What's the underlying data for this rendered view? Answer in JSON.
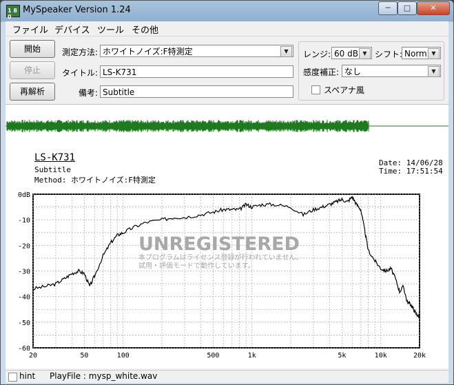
{
  "window": {
    "title": "MySpeaker Version 1.24",
    "icon_label": "1 8 0",
    "min": "─",
    "max": "□",
    "close": "✕"
  },
  "menu": [
    "ファイル",
    "デバイス",
    "ツール",
    "その他"
  ],
  "buttons": {
    "start": "開始",
    "stop": "停止",
    "reanalyze": "再解析"
  },
  "form": {
    "method_label": "測定方法:",
    "method_value": "ホワイトノイズ:F特測定",
    "title_label": "タイトル:",
    "title_value": "LS-K731",
    "note_label": "備考:",
    "note_value": "Subtitle"
  },
  "settings": {
    "range_label": "レンジ:",
    "range_value": "60 dB",
    "shift_label": "シフト:",
    "shift_value": "Norm.",
    "sens_label": "感度補正:",
    "sens_value": "なし",
    "spectrum_label": "スペアナ風",
    "spectrum_checked": false
  },
  "plot_header": {
    "title": "LS-K731",
    "subtitle": "Subtitle",
    "method": "Method:  ホワイトノイズ:F特測定",
    "date": "Date: 14/06/28",
    "time": "Time: 17:51:54"
  },
  "watermark": {
    "main": "UNREGISTERED",
    "line1": "本プログラムはライセンス登録が行われていません。",
    "line2": "試用・評価モードで動作しています。"
  },
  "status": {
    "hint_label": "hint",
    "playfile": "PlayFile :  mysp_white.wav"
  },
  "colors": {
    "wave": "#1f7a1f",
    "curve": "#000000"
  },
  "chart_data": {
    "type": "line",
    "xscale": "log",
    "xlim": [
      20,
      20000
    ],
    "ylim": [
      -60,
      0
    ],
    "x_ticks": [
      "20",
      "50",
      "100",
      "500",
      "1k",
      "5k",
      "10k",
      "20k"
    ],
    "y_ticks": [
      "0dB",
      "-10",
      "-20",
      "-30",
      "-40",
      "-50",
      "-60"
    ],
    "series": [
      {
        "x": [
          20,
          25,
          30,
          35,
          40,
          45,
          50,
          55,
          60,
          70,
          80,
          90,
          100,
          120,
          150,
          200,
          250,
          300,
          400,
          500,
          600,
          700,
          800,
          900,
          1000,
          1200,
          1500,
          2000,
          2500,
          3000,
          3500,
          4000,
          4500,
          5000,
          5500,
          6000,
          6500,
          7000,
          7500,
          8000,
          9000,
          10000,
          11000,
          12000,
          13000,
          14000,
          15000,
          16000,
          17000,
          18000,
          19000,
          20000
        ],
        "y": [
          -37,
          -36,
          -35,
          -33,
          -31,
          -30,
          -31,
          -36,
          -32,
          -24,
          -19,
          -16,
          -15,
          -13,
          -11,
          -10,
          -9,
          -9,
          -8,
          -7,
          -6,
          -6,
          -6,
          -4,
          -5,
          -4,
          -4,
          -5,
          -8,
          -6,
          -5,
          -4,
          -3,
          -2,
          -3,
          -1,
          -4,
          -6,
          -14,
          -22,
          -26,
          -29,
          -30,
          -29,
          -33,
          -38,
          -36,
          -42,
          -43,
          -45,
          -47,
          -48
        ]
      }
    ]
  }
}
